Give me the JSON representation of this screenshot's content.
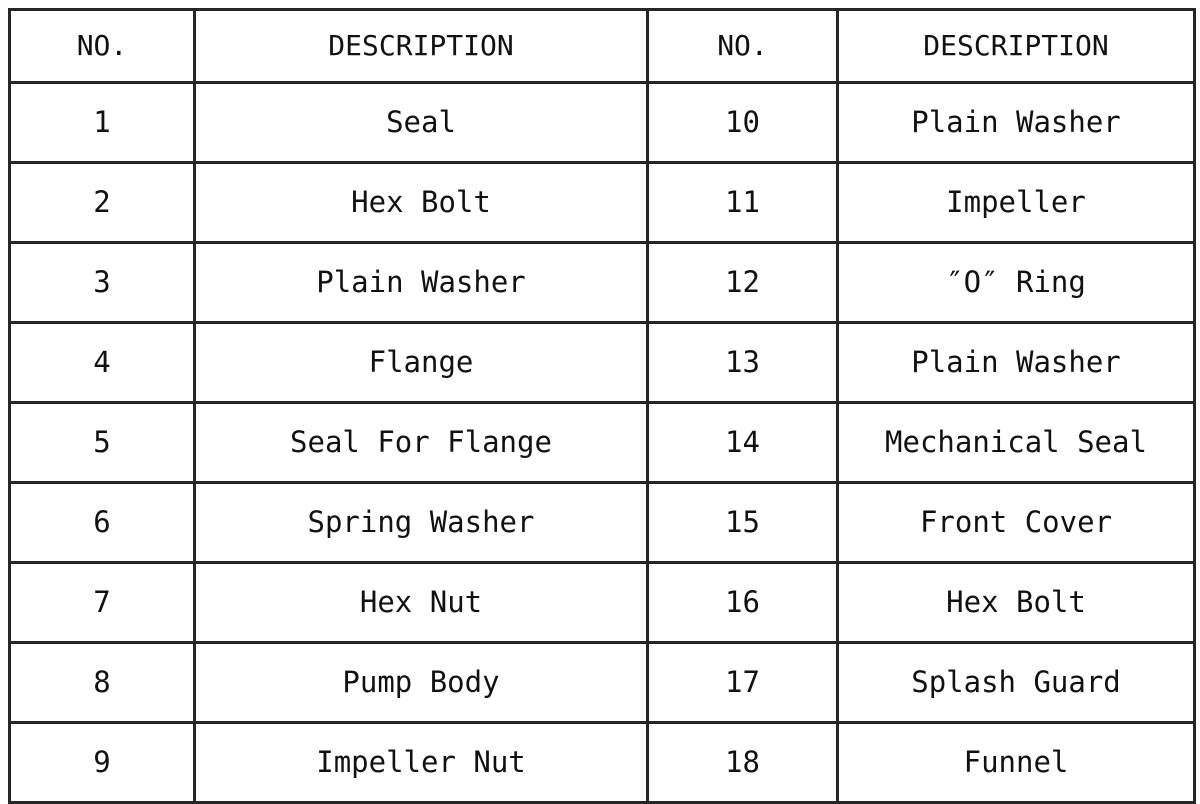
{
  "table": {
    "headers": [
      "NO.",
      "DESCRIPTION",
      "NO.",
      "DESCRIPTION"
    ],
    "rows": [
      {
        "no_left": "1",
        "desc_left": "Seal",
        "no_right": "10",
        "desc_right": "Plain Washer"
      },
      {
        "no_left": "2",
        "desc_left": "Hex Bolt",
        "no_right": "11",
        "desc_right": "Impeller"
      },
      {
        "no_left": "3",
        "desc_left": "Plain Washer",
        "no_right": "12",
        "desc_right": "″O″ Ring"
      },
      {
        "no_left": "4",
        "desc_left": "Flange",
        "no_right": "13",
        "desc_right": "Plain Washer"
      },
      {
        "no_left": "5",
        "desc_left": "Seal For Flange",
        "no_right": "14",
        "desc_right": "Mechanical Seal"
      },
      {
        "no_left": "6",
        "desc_left": "Spring Washer",
        "no_right": "15",
        "desc_right": "Front Cover"
      },
      {
        "no_left": "7",
        "desc_left": "Hex Nut",
        "no_right": "16",
        "desc_right": "Hex Bolt"
      },
      {
        "no_left": "8",
        "desc_left": "Pump Body",
        "no_right": "17",
        "desc_right": "Splash Guard"
      },
      {
        "no_left": "9",
        "desc_left": "Impeller Nut",
        "no_right": "18",
        "desc_right": "Funnel"
      }
    ],
    "colors": {
      "border": "#262626",
      "background": "#ffffff",
      "text": "#111111"
    }
  }
}
